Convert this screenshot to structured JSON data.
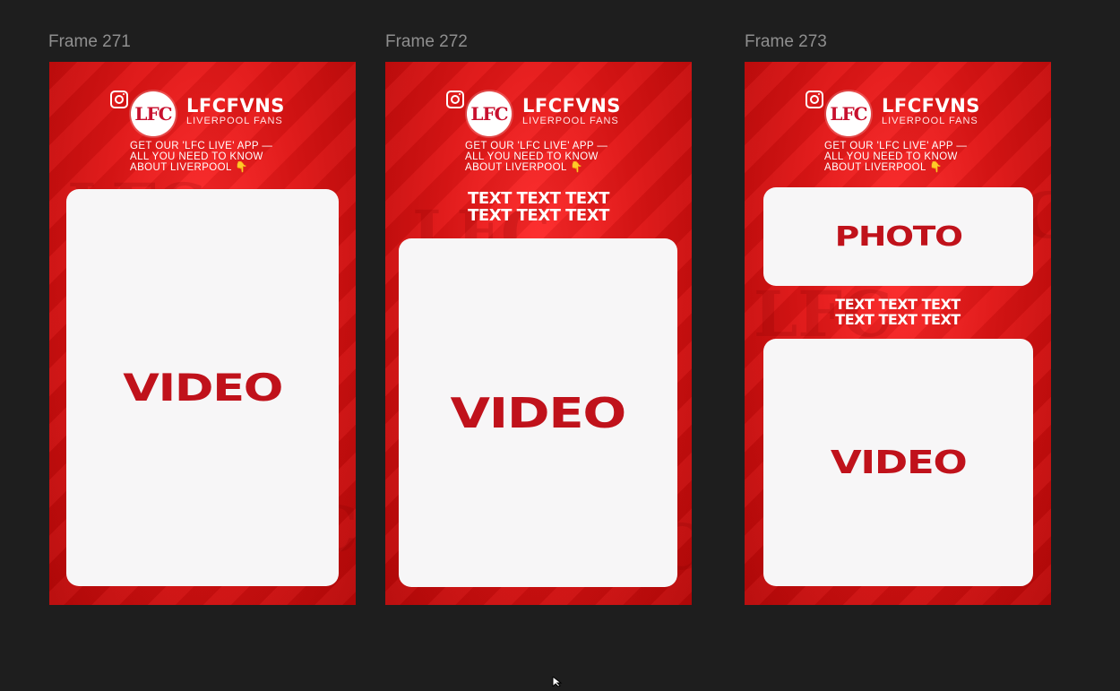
{
  "frames": [
    {
      "label": "Frame 271",
      "brand_name": "LFCFVNS",
      "brand_sub": "LIVERPOOL FANS",
      "crest_text": "LFC",
      "promo_lines": [
        "GET OUR 'LFC LIVE' APP —",
        "ALL YOU NEED TO KNOW",
        "ABOUT LIVERPOOL 👇"
      ],
      "video_label": "VIDEO"
    },
    {
      "label": "Frame 272",
      "brand_name": "LFCFVNS",
      "brand_sub": "LIVERPOOL FANS",
      "crest_text": "LFC",
      "promo_lines": [
        "GET OUR 'LFC LIVE' APP —",
        "ALL YOU NEED TO KNOW",
        "ABOUT LIVERPOOL 👇"
      ],
      "text_lines": [
        "TEXT TEXT TEXT",
        "TEXT TEXT TEXT"
      ],
      "video_label": "VIDEO"
    },
    {
      "label": "Frame 273",
      "brand_name": "LFCFVNS",
      "brand_sub": "LIVERPOOL FANS",
      "crest_text": "LFC",
      "promo_lines": [
        "GET OUR 'LFC LIVE' APP —",
        "ALL YOU NEED TO KNOW",
        "ABOUT LIVERPOOL 👇"
      ],
      "photo_label": "PHOTO",
      "text_lines": [
        "TEXT TEXT TEXT",
        "TEXT TEXT TEXT"
      ],
      "video_label": "VIDEO"
    }
  ],
  "icons": {
    "social": "instagram-icon",
    "cursor": "mouse-pointer-icon"
  },
  "colors": {
    "canvas": "#1e1e1e",
    "frame_red": "#e01515",
    "card_bg": "#f7f6f7",
    "card_text": "#c0121b"
  }
}
